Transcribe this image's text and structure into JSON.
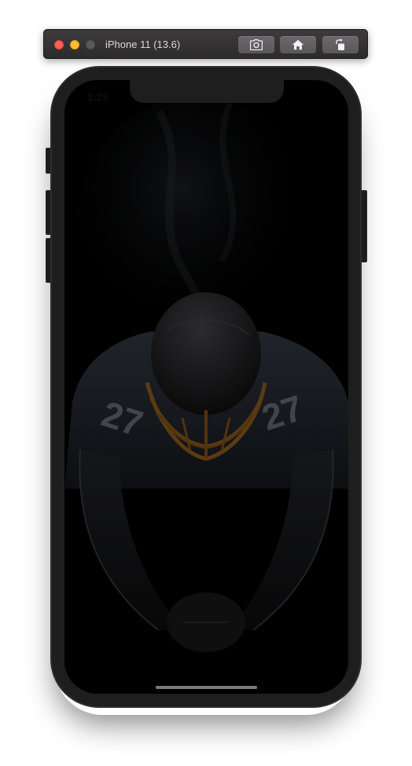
{
  "simulator": {
    "device_title": "iPhone 11 (13.6)",
    "buttons": [
      {
        "name": "screenshot",
        "icon": "camera-icon"
      },
      {
        "name": "home",
        "icon": "home-icon"
      },
      {
        "name": "rotate",
        "icon": "rotate-icon"
      }
    ],
    "traffic_lights": {
      "close": "#fe5f57",
      "minimize": "#febc2e",
      "maximize": "#5b5a5b"
    }
  },
  "status_bar": {
    "time": "3:29"
  },
  "background": {
    "jersey_number": "27",
    "colors": {
      "screen": "#000000",
      "jersey": "#262b33",
      "helmet": "#2a2a2c",
      "facemask": "#8a5a1c"
    }
  }
}
